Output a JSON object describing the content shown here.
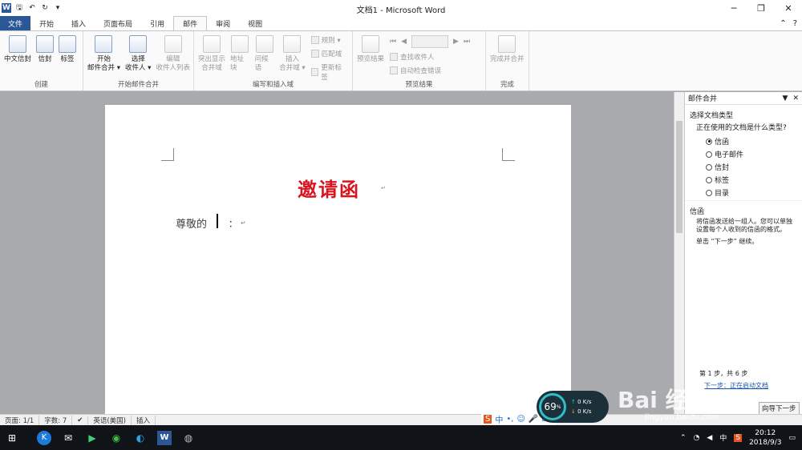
{
  "window": {
    "title": "文档1 - Microsoft Word"
  },
  "qat": {
    "word_logo": "W",
    "save": "🖫",
    "undo": "↶",
    "redo": "↻",
    "customize": "▾"
  },
  "window_buttons": {
    "minimize": "─",
    "restore": "❐",
    "close": "✕"
  },
  "tabs": [
    "文件",
    "开始",
    "插入",
    "页面布局",
    "引用",
    "邮件",
    "审阅",
    "视图"
  ],
  "tabs_right": {
    "collapse": "⌃",
    "help": "?"
  },
  "ribbon": {
    "groups": {
      "create": {
        "label": "创建",
        "buttons": [
          "中文信封",
          "信封",
          "标签"
        ]
      },
      "start_merge": {
        "label": "开始邮件合并",
        "start": "开始\n邮件合并 ▾",
        "select": "选择\n收件人 ▾",
        "edit": "编辑\n收件人列表"
      },
      "write_insert": {
        "label": "编写和插入域",
        "highlight": "突出显示\n合并域",
        "address": "地址块",
        "greeting": "问候语",
        "insert": "插入\n合并域 ▾",
        "rules": "规则 ▾",
        "match": "匹配域",
        "update": "更新标签"
      },
      "preview": {
        "label": "预览结果",
        "preview_btn": "预览结果",
        "find": "查找收件人",
        "autocheck": "自动检查错误"
      },
      "finish": {
        "label": "完成",
        "finish_btn": "完成并合并"
      }
    }
  },
  "document": {
    "title": "邀请函",
    "salutation": "尊敬的",
    "colon": "：",
    "para_mark": "↵"
  },
  "pane": {
    "title": "邮件合并",
    "section": "选择文档类型",
    "question": "正在使用的文档是什么类型?",
    "options": [
      "信函",
      "电子邮件",
      "信封",
      "标签",
      "目录"
    ],
    "selected": "信函",
    "desc_title": "信函",
    "desc": "将信函发送给一组人。您可以单独设置每个人收到的信函的格式。",
    "next_hint": "单击 “下一步” 继续。",
    "step": "第 1 步，共 6 步",
    "next_link": "下一步：正在启动文档",
    "wizard_btn": "向导下一步"
  },
  "status": {
    "page": "页面: 1/1",
    "words": "字数: 7",
    "lang": "英语(美国)",
    "mode": "插入"
  },
  "speed": {
    "percent": "69",
    "unit": "%",
    "up": "0 K/s",
    "down": "0 K/s"
  },
  "ime": [
    "S",
    "中",
    "•,",
    "☺",
    "🎤",
    "⌨"
  ],
  "watermark": {
    "brand": "Bai 经验",
    "url": "jingyan.baidu.com"
  },
  "taskbar": {
    "time": "20:12",
    "date": "2018/9/3",
    "ime": "中"
  }
}
